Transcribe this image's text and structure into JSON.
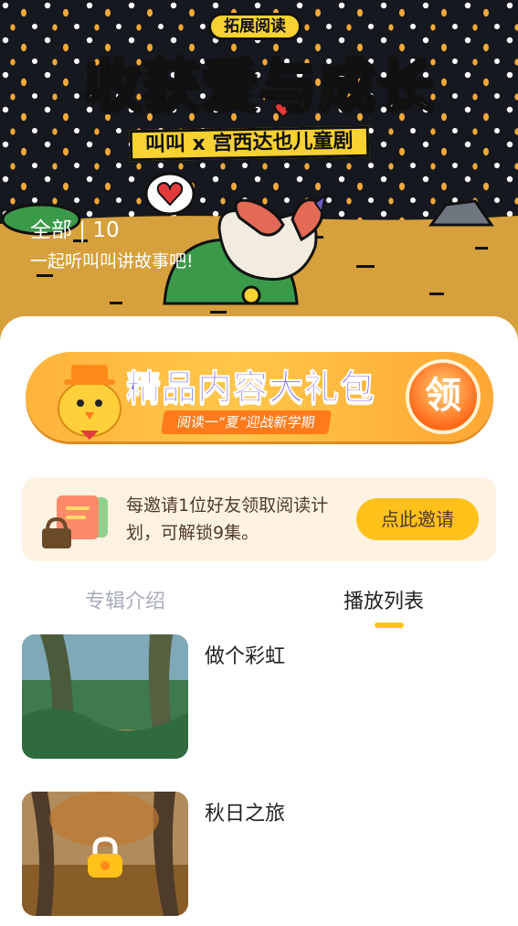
{
  "hero": {
    "tag": "拓展阅读",
    "title": "收获爱与成长",
    "subtitle": "叫叫 x 宫西达也儿童剧",
    "count_text": "全部 | 10",
    "description": "一起听叫叫讲故事吧!"
  },
  "gift_banner": {
    "title": "精品内容大礼包",
    "subtitle": "阅读一“夏”迎战新学期",
    "claim_label": "领"
  },
  "invite": {
    "text": "每邀请1位好友领取阅读计划，可解锁9集。",
    "button_label": "点此邀请"
  },
  "tabs": [
    {
      "label": "专辑介绍",
      "active": false
    },
    {
      "label": "播放列表",
      "active": true
    }
  ],
  "episodes": [
    {
      "title": "做个彩虹",
      "locked": false
    },
    {
      "title": "秋日之旅",
      "locked": true
    }
  ],
  "colors": {
    "accent": "#ffc11a",
    "hero_bg": "#16181f",
    "ground": "#d6a03c",
    "gift_purple": "#6c4de8",
    "invite_bg": "#fef3e2"
  },
  "icons": [
    "heart-icon",
    "lock-icon",
    "chick-mascot-icon",
    "book-lock-icon"
  ]
}
